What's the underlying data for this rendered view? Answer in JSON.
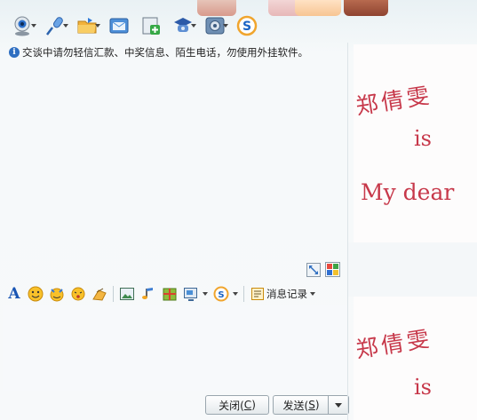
{
  "notice": {
    "text": "交谈中请勿轻信汇款、中奖信息、陌生电话，勿使用外挂软件。"
  },
  "toolbar": {
    "items": [
      "video-call",
      "voice-call",
      "send-file",
      "send-sms",
      "create-group",
      "remote-assist",
      "app-settings",
      "qq-apps"
    ]
  },
  "input_toolbar": {
    "font_label": "A",
    "history_label": "消息记录"
  },
  "buttons": {
    "close_label": "关闭(",
    "close_key": "C",
    "close_tail": ")",
    "send_label": "发送(",
    "send_key": "S",
    "send_tail": ")"
  },
  "profile_panel": {
    "name": "郑倩雯",
    "line2": "is",
    "line3": "My dear"
  },
  "colors": {
    "accent": "#1a56b4",
    "handwriting": "#c7384a"
  }
}
